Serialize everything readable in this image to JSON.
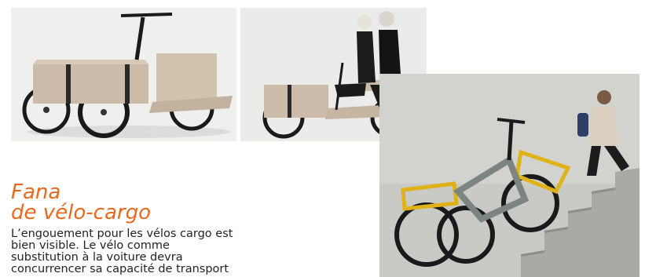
{
  "colors": {
    "accent": "#e8691e",
    "text": "#222222",
    "cargo_box": "#c9b8a5",
    "frame_yellow": "#e0b21a",
    "frame_grey": "#7d8580"
  },
  "article": {
    "heading_line1": "Fana",
    "heading_line2": "de vélo-cargo",
    "body_lines": [
      "L’engouement pour les vélos cargo est",
      "bien visible. Le vélo comme",
      "substitution à la voiture devra",
      "concurrencer sa capacité de transport"
    ]
  }
}
